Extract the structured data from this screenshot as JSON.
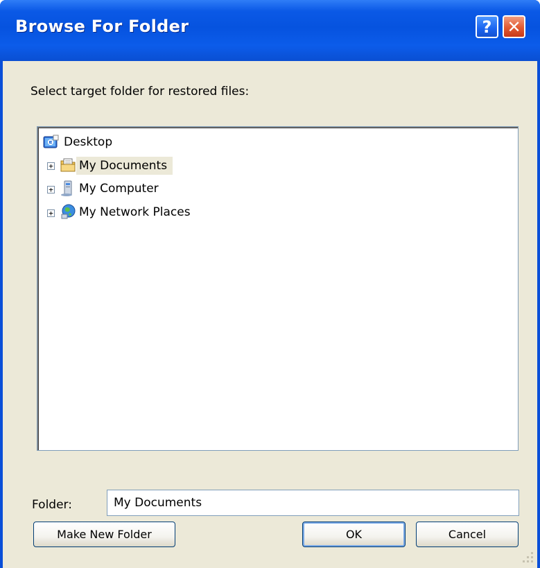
{
  "window": {
    "title": "Browse For Folder",
    "help_label": "?",
    "close_label": "✕"
  },
  "prompt": "Select target folder for restored files:",
  "tree": {
    "root": {
      "label": "Desktop",
      "icon": "desktop-icon"
    },
    "items": [
      {
        "label": "My Documents",
        "icon": "my-documents-icon",
        "expander": "+",
        "selected": true
      },
      {
        "label": "My Computer",
        "icon": "my-computer-icon",
        "expander": "+",
        "selected": false
      },
      {
        "label": "My Network Places",
        "icon": "network-places-icon",
        "expander": "+",
        "selected": false
      }
    ]
  },
  "folder": {
    "label": "Folder:",
    "value": "My Documents"
  },
  "buttons": {
    "make_new_folder": "Make New Folder",
    "ok": "OK",
    "cancel": "Cancel"
  },
  "colors": {
    "titlebar": "#0653df",
    "client": "#ece9d8",
    "close": "#e25a32"
  }
}
